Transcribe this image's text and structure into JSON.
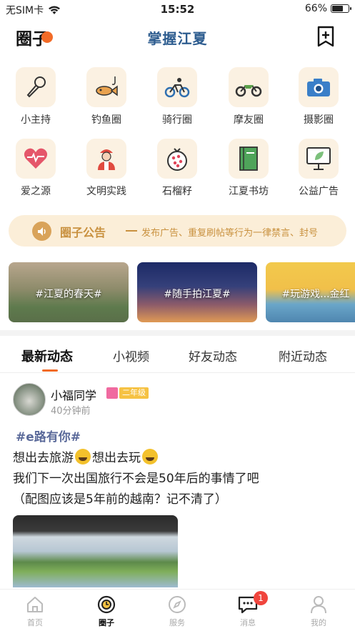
{
  "status_bar": {
    "carrier": "无SIM卡",
    "time": "15:52",
    "battery": "66%",
    "battery_level": 0.66
  },
  "header": {
    "title": "圈子",
    "app_title": "掌握江夏"
  },
  "grid": [
    {
      "label": "小主持",
      "icon": "microphone-icon"
    },
    {
      "label": "钓鱼圈",
      "icon": "fish-icon"
    },
    {
      "label": "骑行圈",
      "icon": "bicycle-icon"
    },
    {
      "label": "摩友圈",
      "icon": "motorcycle-icon"
    },
    {
      "label": "摄影圈",
      "icon": "camera-icon"
    },
    {
      "label": "爱之源",
      "icon": "heart-icon"
    },
    {
      "label": "文明实践",
      "icon": "volunteer-icon"
    },
    {
      "label": "石榴籽",
      "icon": "pomegranate-icon"
    },
    {
      "label": "江夏书坊",
      "icon": "book-icon"
    },
    {
      "label": "公益广告",
      "icon": "billboard-icon"
    }
  ],
  "notice": {
    "title": "圈子公告",
    "text": "发布广告、重复刷帖等行为一律禁言、封号"
  },
  "topics": [
    {
      "tag": "#江夏的春天#"
    },
    {
      "tag": "#随手拍江夏#"
    },
    {
      "tag": "#玩游戏...金红"
    }
  ],
  "tabs": [
    "最新动态",
    "小视频",
    "好友动态",
    "附近动态"
  ],
  "post": {
    "username": "小福同学",
    "grade": "二年级",
    "time": "40分钟前",
    "hashtag": "#e路有你#",
    "line1_a": "想出去旅游",
    "line1_b": "想出去玩",
    "line2": "我们下一次出国旅行不会是50年后的事情了吧",
    "line3": "（配图应该是5年前的越南？记不清了）"
  },
  "bottom_nav": [
    {
      "label": "首页",
      "icon": "home-icon"
    },
    {
      "label": "圈子",
      "icon": "circle-icon"
    },
    {
      "label": "服务",
      "icon": "compass-icon"
    },
    {
      "label": "消息",
      "icon": "message-icon",
      "badge": "1"
    },
    {
      "label": "我的",
      "icon": "profile-icon"
    }
  ],
  "colors": {
    "accent": "#f26b27",
    "title_blue": "#2d5c8f",
    "notice_gold": "#c9913f",
    "tile_bg": "#fbf1e2"
  }
}
